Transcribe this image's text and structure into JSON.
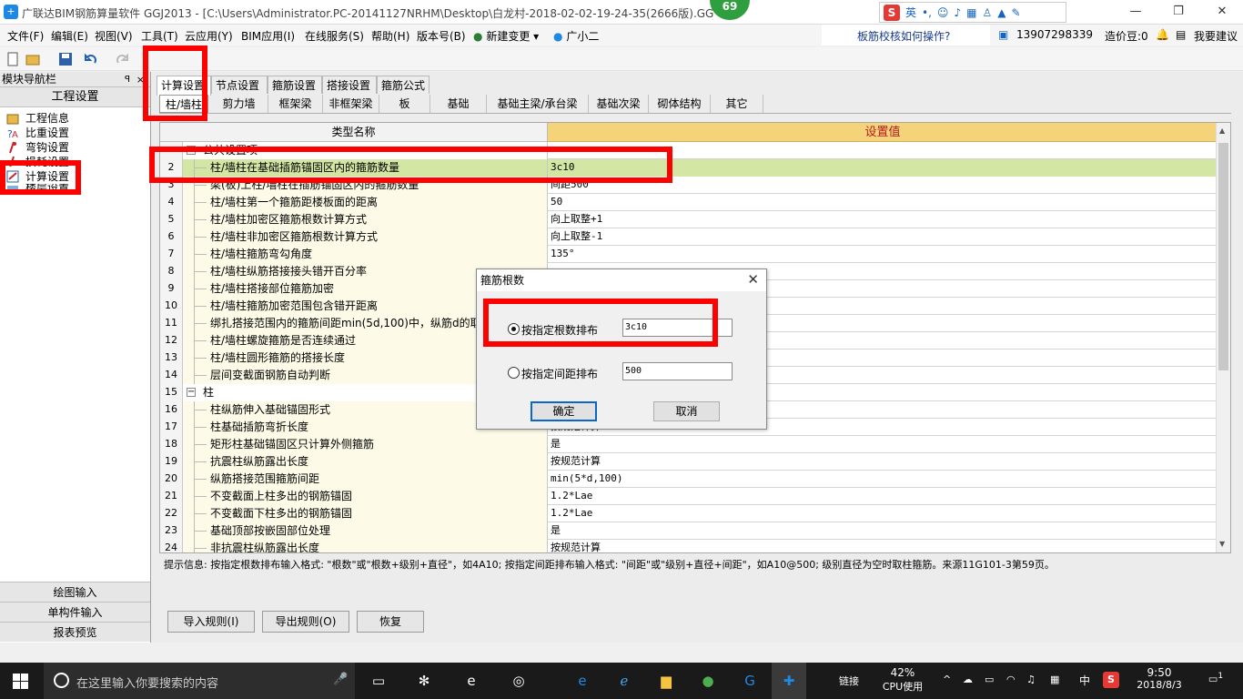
{
  "window": {
    "title": "广联达BIM钢筋算量软件 GGJ2013 - [C:\\Users\\Administrator.PC-20141127NRHM\\Desktop\\白龙村-2018-02-02-19-24-35(2666版).GGJ12]",
    "badge": "69",
    "ime": {
      "lang": "英"
    },
    "controls": {
      "minimize": "—",
      "restore": "❐",
      "close": "✕"
    }
  },
  "menubar": {
    "items": [
      "文件(F)",
      "编辑(E)",
      "视图(V)",
      "工具(T)",
      "云应用(Y)",
      "BIM应用(I)",
      "在线服务(S)",
      "帮助(H)",
      "版本号(B)",
      "新建变更 ▾",
      "广小二"
    ],
    "help_question": "板筋校核如何操作?",
    "phone": "13907298339",
    "points": "造价豆:0",
    "suggest": "我要建议"
  },
  "nav": {
    "header": "模块导航栏",
    "pin": "ꟼ",
    "close": "×",
    "section": "工程设置",
    "items": [
      "工程信息",
      "比重设置",
      "弯钩设置",
      "损耗设置",
      "计算设置",
      "楼层设置"
    ],
    "bottom": [
      "绘图输入",
      "单构件输入",
      "报表预览"
    ]
  },
  "tabs_top": [
    "计算设置",
    "节点设置",
    "箍筋设置",
    "搭接设置",
    "箍筋公式"
  ],
  "tabs_sub": [
    "柱/墙柱",
    "剪力墙",
    "框架梁",
    "非框架梁",
    "板",
    "基础",
    "基础主梁/承台梁",
    "基础次梁",
    "砌体结构",
    "其它"
  ],
  "grid": {
    "col_name": "类型名称",
    "col_value": "设置值",
    "rows": [
      {
        "num": "",
        "name": "公共设置项",
        "value": "",
        "group": true
      },
      {
        "num": "2",
        "name": "柱/墙柱在基础插筋锚固区内的箍筋数量",
        "value": "3c10",
        "selected": true
      },
      {
        "num": "3",
        "name": "梁(板)上柱/墙柱在插筋锚固区内的箍筋数量",
        "value": "间距500"
      },
      {
        "num": "4",
        "name": "柱/墙柱第一个箍筋距楼板面的距离",
        "value": "50"
      },
      {
        "num": "5",
        "name": "柱/墙柱加密区箍筋根数计算方式",
        "value": "向上取整+1"
      },
      {
        "num": "6",
        "name": "柱/墙柱非加密区箍筋根数计算方式",
        "value": "向上取整-1"
      },
      {
        "num": "7",
        "name": "柱/墙柱箍筋弯勾角度",
        "value": "135°"
      },
      {
        "num": "8",
        "name": "柱/墙柱纵筋搭接接头错开百分率",
        "value": ""
      },
      {
        "num": "9",
        "name": "柱/墙柱搭接部位箍筋加密",
        "value": ""
      },
      {
        "num": "10",
        "name": "柱/墙柱箍筋加密范围包含错开距离",
        "value": ""
      },
      {
        "num": "11",
        "name": "绑扎搭接范围内的箍筋间距min(5d,100)中，纵筋d的取值",
        "value": ""
      },
      {
        "num": "12",
        "name": "柱/墙柱螺旋箍筋是否连续通过",
        "value": ""
      },
      {
        "num": "13",
        "name": "柱/墙柱圆形箍筋的搭接长度",
        "value": ""
      },
      {
        "num": "14",
        "name": "层间变截面钢筋自动判断",
        "value": ""
      },
      {
        "num": "15",
        "name": "柱",
        "value": "",
        "group": true
      },
      {
        "num": "16",
        "name": "柱纵筋伸入基础锚固形式",
        "value": ""
      },
      {
        "num": "17",
        "name": "柱基础插筋弯折长度",
        "value": "按规范计算"
      },
      {
        "num": "18",
        "name": "矩形柱基础锚固区只计算外侧箍筋",
        "value": "是"
      },
      {
        "num": "19",
        "name": "抗震柱纵筋露出长度",
        "value": "按规范计算"
      },
      {
        "num": "20",
        "name": "纵筋搭接范围箍筋间距",
        "value": "min(5*d,100)"
      },
      {
        "num": "21",
        "name": "不变截面上柱多出的钢筋锚固",
        "value": "1.2*Lae"
      },
      {
        "num": "22",
        "name": "不变截面下柱多出的钢筋锚固",
        "value": "1.2*Lae"
      },
      {
        "num": "23",
        "name": "基础顶部按嵌固部位处理",
        "value": "是"
      },
      {
        "num": "24",
        "name": "非抗震柱纵筋露出长度",
        "value": "按规范计算"
      }
    ]
  },
  "hint": "提示信息: 按指定根数排布输入格式: \"根数\"或\"根数+级别+直径\"，如4A10; 按指定间距排布输入格式: \"间距\"或\"级别+直径+间距\"，如A10@500; 级别直径为空时取柱箍筋。来源11G101-3第59页。",
  "bottom_buttons": [
    "导入规则(I)",
    "导出规则(O)",
    "恢复"
  ],
  "dialog": {
    "title": "箍筋根数",
    "close": "✕",
    "option1": "按指定根数排布",
    "value1": "3c10",
    "option2": "按指定间距排布",
    "value2": "500",
    "ok": "确定",
    "cancel": "取消"
  },
  "taskbar": {
    "search_placeholder": "在这里输入你要搜索的内容",
    "mic": "🎤",
    "link": "链接",
    "cpu_pct": "42%",
    "cpu_label": "CPU使用",
    "lang": "中",
    "time": "9:50",
    "date": "2018/8/3",
    "notif": "1"
  },
  "colors": {
    "accent_red": "#ff0000",
    "header_value": "#f5d37a",
    "selected_row": "#d4e6a4",
    "name_col": "#fdfbe8"
  }
}
